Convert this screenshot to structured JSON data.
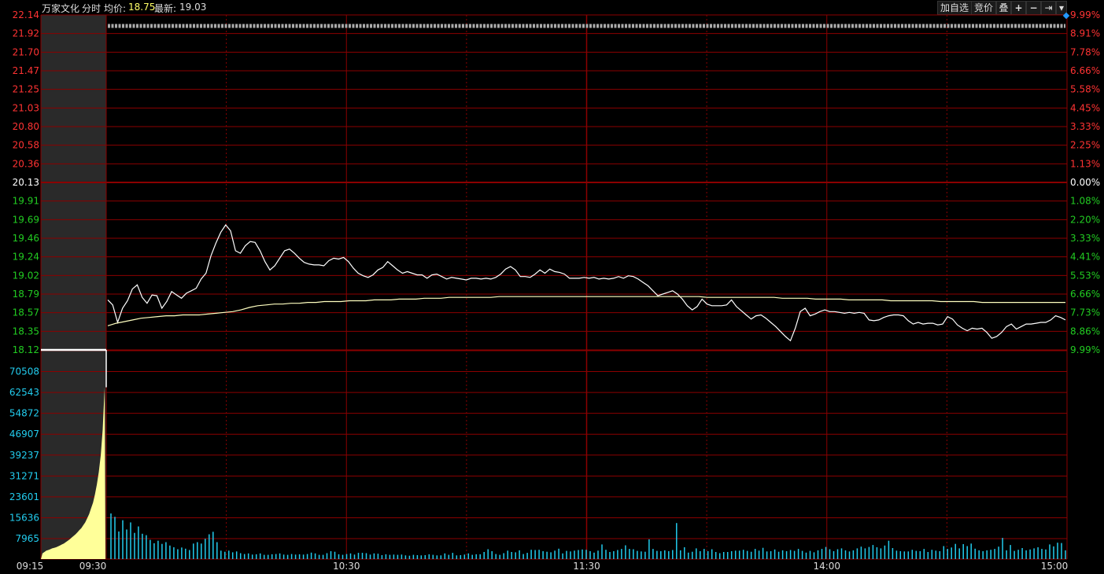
{
  "header": {
    "stock_name": "万家文化",
    "mode": "分时",
    "avg_label": "均价:",
    "avg_value": "18.75",
    "last_label": "最新:",
    "last_value": "19.03"
  },
  "toolbar": {
    "add_watch": "加自选",
    "auction": "竞价",
    "overlay": "叠",
    "zoom_in": "+",
    "zoom_out": "−",
    "goto_end": "⇥",
    "dropdown": "▾"
  },
  "colors": {
    "grid": "#8b0000",
    "price_line": "#ffffff",
    "avg_line": "#ffffc0",
    "up_text": "#ff3333",
    "down_text": "#22cc22",
    "vol_text": "#22ccee",
    "volume_bar": "#22ccee",
    "auction_fill": "#ffff99"
  },
  "chart_data": {
    "type": "line",
    "prev_close": 20.13,
    "price_ticks": [
      "22.14",
      "21.92",
      "21.70",
      "21.47",
      "21.25",
      "21.03",
      "20.80",
      "20.58",
      "20.36",
      "20.13",
      "19.91",
      "19.69",
      "19.46",
      "19.24",
      "19.02",
      "18.79",
      "18.57",
      "18.35",
      "18.12"
    ],
    "pct_ticks": [
      "9.99%",
      "8.91%",
      "7.78%",
      "6.66%",
      "5.58%",
      "4.45%",
      "3.33%",
      "2.25%",
      "1.13%",
      "0.00%",
      "1.08%",
      "2.20%",
      "3.33%",
      "4.41%",
      "5.53%",
      "6.66%",
      "7.73%",
      "8.86%",
      "9.99%"
    ],
    "volume_ticks": [
      "70508",
      "62543",
      "54872",
      "46907",
      "39237",
      "31271",
      "23601",
      "15636",
      "7965"
    ],
    "time_ticks": [
      "09:15",
      "09:30",
      "10:30",
      "11:30",
      "14:00",
      "15:00"
    ],
    "price_range": [
      18.12,
      22.14
    ],
    "volume_range": [
      0,
      74000
    ],
    "price_series": [
      18.72,
      18.66,
      18.45,
      18.62,
      18.71,
      18.85,
      18.9,
      18.75,
      18.68,
      18.78,
      18.77,
      18.62,
      18.7,
      18.82,
      18.78,
      18.74,
      18.8,
      18.83,
      18.86,
      18.97,
      19.04,
      19.25,
      19.4,
      19.53,
      19.62,
      19.55,
      19.31,
      19.28,
      19.37,
      19.42,
      19.41,
      19.31,
      19.18,
      19.08,
      19.13,
      19.22,
      19.31,
      19.33,
      19.28,
      19.22,
      19.17,
      19.15,
      19.14,
      19.14,
      19.13,
      19.19,
      19.22,
      19.21,
      19.23,
      19.18,
      19.1,
      19.04,
      19.01,
      18.99,
      19.02,
      19.08,
      19.11,
      19.18,
      19.13,
      19.08,
      19.04,
      19.06,
      19.04,
      19.02,
      19.02,
      18.98,
      19.02,
      19.03,
      19.0,
      18.97,
      18.99,
      18.98,
      18.97,
      18.96,
      18.98,
      18.98,
      18.97,
      18.98,
      18.97,
      18.99,
      19.03,
      19.09,
      19.12,
      19.08,
      19.0,
      19.0,
      18.99,
      19.03,
      19.08,
      19.04,
      19.09,
      19.06,
      19.05,
      19.03,
      18.98,
      18.98,
      18.98,
      18.99,
      18.98,
      18.99,
      18.97,
      18.98,
      18.97,
      18.98,
      19.0,
      18.98,
      19.01,
      19.0,
      18.97,
      18.93,
      18.89,
      18.83,
      18.77,
      18.79,
      18.81,
      18.83,
      18.79,
      18.73,
      18.65,
      18.6,
      18.64,
      18.73,
      18.67,
      18.65,
      18.65,
      18.65,
      18.66,
      18.72,
      18.64,
      18.59,
      18.54,
      18.49,
      18.53,
      18.54,
      18.5,
      18.45,
      18.4,
      18.34,
      18.28,
      18.23,
      18.38,
      18.58,
      18.62,
      18.53,
      18.55,
      18.58,
      18.6,
      18.58,
      18.58,
      18.57,
      18.56,
      18.57,
      18.56,
      18.57,
      18.56,
      18.48,
      18.47,
      18.48,
      18.51,
      18.53,
      18.54,
      18.54,
      18.53,
      18.47,
      18.43,
      18.45,
      18.43,
      18.44,
      18.44,
      18.42,
      18.43,
      18.52,
      18.49,
      18.42,
      18.38,
      18.35,
      18.38,
      18.37,
      18.38,
      18.33,
      18.26,
      18.28,
      18.33,
      18.4,
      18.43,
      18.37,
      18.4,
      18.43,
      18.43,
      18.44,
      18.45,
      18.45,
      18.48,
      18.53,
      18.51,
      18.48
    ],
    "avg_series": [
      18.41,
      18.44,
      18.46,
      18.48,
      18.5,
      18.51,
      18.52,
      18.53,
      18.53,
      18.54,
      18.54,
      18.54,
      18.55,
      18.56,
      18.57,
      18.58,
      18.6,
      18.63,
      18.65,
      18.66,
      18.67,
      18.67,
      18.68,
      18.68,
      18.69,
      18.69,
      18.7,
      18.7,
      18.7,
      18.71,
      18.71,
      18.71,
      18.72,
      18.72,
      18.72,
      18.73,
      18.73,
      18.73,
      18.74,
      18.74,
      18.74,
      18.75,
      18.75,
      18.75,
      18.75,
      18.75,
      18.75,
      18.76,
      18.76,
      18.76,
      18.76,
      18.76,
      18.76,
      18.76,
      18.76,
      18.76,
      18.76,
      18.76,
      18.76,
      18.76,
      18.76,
      18.76,
      18.76,
      18.76,
      18.76,
      18.76,
      18.76,
      18.76,
      18.76,
      18.76,
      18.76,
      18.76,
      18.75,
      18.75,
      18.75,
      18.75,
      18.75,
      18.75,
      18.75,
      18.75,
      18.75,
      18.74,
      18.74,
      18.74,
      18.74,
      18.73,
      18.73,
      18.73,
      18.73,
      18.72,
      18.72,
      18.72,
      18.72,
      18.72,
      18.71,
      18.71,
      18.71,
      18.71,
      18.71,
      18.71,
      18.7,
      18.7,
      18.7,
      18.7,
      18.7,
      18.69,
      18.69,
      18.69,
      18.69,
      18.69,
      18.69,
      18.69,
      18.69,
      18.69,
      18.69,
      18.69
    ],
    "volume_series": [
      16200,
      15000,
      9800,
      13800,
      10500,
      13000,
      9300,
      11600,
      9000,
      8500,
      6800,
      5600,
      6500,
      5400,
      6000,
      4800,
      4200,
      3500,
      4100,
      3700,
      3200,
      5500,
      6000,
      5500,
      7200,
      8800,
      9700,
      6000,
      3000,
      2600,
      3000,
      2400,
      2700,
      2100,
      1800,
      2000,
      1600,
      1700,
      2000,
      1500,
      1500,
      1700,
      1800,
      2000,
      1600,
      1500,
      1800,
      1600,
      1700,
      1600,
      1800,
      2300,
      2000,
      1500,
      1500,
      2100,
      2800,
      2600,
      1700,
      1500,
      1800,
      2000,
      1600,
      2200,
      2200,
      2100,
      1600,
      2000,
      1900,
      1400,
      1700,
      1500,
      1600,
      1500,
      1600,
      1300,
      1200,
      1500,
      1400,
      1300,
      1400,
      1700,
      1500,
      1300,
      1300,
      2000,
      1500,
      2200,
      1300,
      1400,
      1600,
      2000,
      1500,
      1700,
      1700,
      2500,
      3500,
      2800,
      1800,
      1500,
      2100,
      3000,
      2500,
      2400,
      3100,
      1800,
      2200,
      3300,
      3200,
      3300,
      2800,
      2600,
      2400,
      3000,
      3700,
      2000,
      2900,
      2700,
      3000,
      3200,
      3400,
      3300,
      2800,
      2300,
      3000,
      5200,
      3300,
      2500,
      2800,
      3200,
      3600,
      4900,
      3600,
      3500,
      2900,
      2700,
      2600,
      7000,
      3600,
      2900,
      2800,
      3100,
      2800,
      3200,
      12800,
      3100,
      4200,
      2300,
      2600,
      3800,
      2800,
      3600,
      2800,
      3500,
      2500,
      2100,
      2500,
      2500,
      2800,
      3000,
      3000,
      3300,
      2900,
      2600,
      3600,
      3000,
      4000,
      2700,
      2800,
      3400,
      2600,
      3100,
      2800,
      3200,
      2900,
      3600,
      2900,
      2300,
      2900,
      2400,
      3100,
      3600,
      4300,
      3500,
      2800,
      3500,
      3800,
      3100,
      2700,
      3100,
      3800,
      4400,
      3800,
      4300,
      5000,
      4200,
      3800,
      4800,
      6500,
      3900,
      3000,
      2800,
      2700,
      2700,
      3300,
      2900,
      2800,
      3600,
      2500,
      3300,
      3000,
      2800,
      4600,
      3600,
      4100,
      5400,
      3800,
      5300,
      4600,
      5500,
      3700,
      3100,
      2800,
      3100,
      3300,
      3600,
      4400,
      7500,
      3100,
      5000,
      2900,
      3300,
      3900,
      3100,
      3400,
      3800,
      4200,
      3600,
      3400,
      5200,
      4500,
      5800,
      5700,
      3100
    ],
    "auction_volume_series": [
      2000,
      2500,
      3000,
      3200,
      3500,
      3800,
      4000,
      4200,
      4500,
      4800,
      5200,
      5500,
      6000,
      6500,
      7000,
      7600,
      8200,
      8800,
      9500,
      10300,
      11000,
      12000,
      13000,
      14500,
      16000,
      18000,
      20000,
      23000,
      26500,
      31000,
      37000,
      46000,
      61000
    ]
  }
}
